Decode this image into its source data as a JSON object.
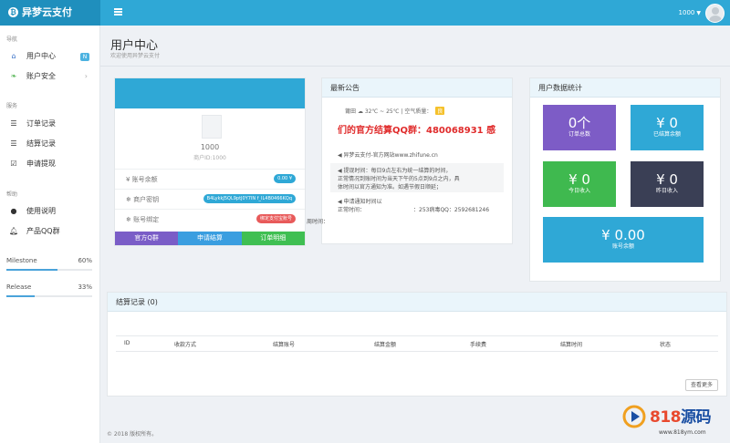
{
  "topbar": {
    "brand": "异梦云支付",
    "coin_icon": "bitcoin-icon",
    "user_label": "1000"
  },
  "sidebar": {
    "section_nav": "导航",
    "section_service": "服务",
    "section_help": "帮助",
    "items": [
      {
        "label": "用户中心",
        "icon": "home-icon",
        "badge": "N",
        "active": true
      },
      {
        "label": "账户安全",
        "icon": "leaf-icon"
      },
      {
        "label": "订单记录",
        "icon": "list-icon"
      },
      {
        "label": "结算记录",
        "icon": "list-icon"
      },
      {
        "label": "申请提现",
        "icon": "check-icon"
      },
      {
        "label": "使用说明",
        "icon": "info-icon"
      },
      {
        "label": "产品QQ群",
        "icon": "bell-icon"
      }
    ],
    "progress": [
      {
        "label": "Milestone",
        "percent_text": "60%",
        "value": 0.6
      },
      {
        "label": "Release",
        "percent_text": "33%",
        "value": 0.33
      }
    ]
  },
  "header": {
    "title": "用户中心",
    "subtitle": "欢迎使用异梦云支付"
  },
  "profile": {
    "uid": "1000",
    "username": "商户ID:1000",
    "rows": [
      {
        "key": "¥ 账号余额",
        "value": "0.00 ¥",
        "color": "#2fa8d6"
      },
      {
        "key": "❄ 商户密钥",
        "value": "B4LykkJ5QL9ptJ0Y7IN f_IL4B0466KQq",
        "color": "#2fa8d6"
      },
      {
        "key": "❄ 账号绑定",
        "value": "绑定支付宝账号",
        "color": "#e85a5a"
      }
    ],
    "buttons": [
      {
        "label": "官方Q群",
        "color": "#7a5dc7"
      },
      {
        "label": "申请结算",
        "color": "#3a9ee0"
      },
      {
        "label": "订单明细",
        "color": "#3fbf52"
      }
    ]
  },
  "notice": {
    "title": "最新公告",
    "weather_city": "莆田",
    "weather_temp": "32℃ ~ 25℃",
    "air_label": "空气质量：",
    "air_value": "良",
    "banner": "们的官方结算QQ群：480068931 感",
    "lines": [
      "◀ 异梦云支付-官方网站www.zhifune.cn",
      "◀ 提现时间：每日9点左右为统一结算的时间，",
      "正常情况到账时间为当天下午的5点到9点之内，具",
      "体时间以官方通知为准。如遇节假日顺延；",
      "◀ 申请通知时间以",
      "正常时间：",
      "：253病毒QQ：2592681246"
    ],
    "stray_text": "周时间："
  },
  "stats": {
    "title": "用户数据统计",
    "tiles": [
      {
        "num": "0个",
        "label": "订单总数",
        "color": "#7d5cc6"
      },
      {
        "num": "¥ 0",
        "label": "已结算余额",
        "color": "#2fa8d6"
      },
      {
        "num": "¥ 0",
        "label": "今日收入",
        "color": "#3fb94f"
      },
      {
        "num": "¥ 0",
        "label": "昨日收入",
        "color": "#3a3f55"
      },
      {
        "num": "¥ 0.00",
        "label": "账号余额",
        "color": "#2fa8d6"
      }
    ]
  },
  "records": {
    "title": "结算记录 (0)",
    "columns": [
      "ID",
      "收款方式",
      "结算账号",
      "结算金额",
      "手续费",
      "结算时间",
      "状态"
    ],
    "more": "查看更多"
  },
  "footer": "© 2018 版权所有。",
  "watermark": {
    "text_num": "818",
    "text_cn": "源码",
    "url": "www.818ym.com"
  }
}
